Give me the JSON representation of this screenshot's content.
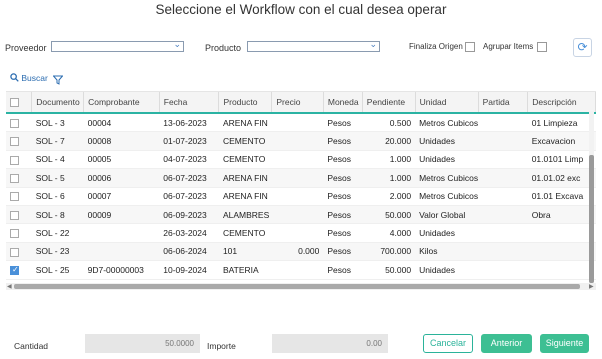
{
  "title": "Seleccione el Workflow con el cual desea operar",
  "filters": {
    "proveedor_label": "Proveedor",
    "producto_label": "Producto",
    "finaliza_label": "Finaliza Origen",
    "agrupar_label": "Agrupar Items"
  },
  "toolbar": {
    "search_label": "Buscar"
  },
  "table": {
    "columns": [
      "Documento",
      "Comprobante",
      "Fecha",
      "Producto",
      "Precio",
      "Moneda",
      "Pendiente",
      "Unidad",
      "Partida",
      "Descripción"
    ],
    "rows": [
      {
        "checked": false,
        "documento": "SOL - 3",
        "comprobante": "00004",
        "fecha": "13-06-2023",
        "producto": "ARENA FIN",
        "precio": "",
        "moneda": "Pesos",
        "pendiente": "0.500",
        "unidad": "Metros Cubicos",
        "partida": "",
        "descripcion": "01 Limpieza"
      },
      {
        "checked": false,
        "documento": "SOL - 7",
        "comprobante": "00008",
        "fecha": "01-07-2023",
        "producto": "CEMENTO",
        "precio": "",
        "moneda": "Pesos",
        "pendiente": "20.000",
        "unidad": "Unidades",
        "partida": "",
        "descripcion": "Excavacion"
      },
      {
        "checked": false,
        "documento": "SOL - 4",
        "comprobante": "00005",
        "fecha": "04-07-2023",
        "producto": "CEMENTO",
        "precio": "",
        "moneda": "Pesos",
        "pendiente": "1.000",
        "unidad": "Unidades",
        "partida": "",
        "descripcion": "01.0101 Limp"
      },
      {
        "checked": false,
        "documento": "SOL - 5",
        "comprobante": "00006",
        "fecha": "06-07-2023",
        "producto": "ARENA FIN",
        "precio": "",
        "moneda": "Pesos",
        "pendiente": "1.000",
        "unidad": "Metros Cubicos",
        "partida": "",
        "descripcion": "01.01.02 exc"
      },
      {
        "checked": false,
        "documento": "SOL - 6",
        "comprobante": "00007",
        "fecha": "06-07-2023",
        "producto": "ARENA FIN",
        "precio": "",
        "moneda": "Pesos",
        "pendiente": "2.000",
        "unidad": "Metros Cubicos",
        "partida": "",
        "descripcion": "01.01 Excava"
      },
      {
        "checked": false,
        "documento": "SOL - 8",
        "comprobante": "00009",
        "fecha": "06-09-2023",
        "producto": "ALAMBRES",
        "precio": "",
        "moneda": "Pesos",
        "pendiente": "50.000",
        "unidad": "Valor Global",
        "partida": "",
        "descripcion": "Obra"
      },
      {
        "checked": false,
        "documento": "SOL - 22",
        "comprobante": "",
        "fecha": "26-03-2024",
        "producto": "CEMENTO",
        "precio": "",
        "moneda": "Pesos",
        "pendiente": "4.000",
        "unidad": "Unidades",
        "partida": "",
        "descripcion": ""
      },
      {
        "checked": false,
        "documento": "SOL - 23",
        "comprobante": "",
        "fecha": "06-06-2024",
        "producto": "101",
        "precio": "0.000",
        "moneda": "Pesos",
        "pendiente": "700.000",
        "unidad": "Kilos",
        "partida": "",
        "descripcion": ""
      },
      {
        "checked": true,
        "documento": "SOL - 25",
        "comprobante": "9D7-00000003",
        "fecha": "10-09-2024",
        "producto": "BATERIA",
        "precio": "",
        "moneda": "Pesos",
        "pendiente": "50.000",
        "unidad": "Unidades",
        "partida": "",
        "descripcion": ""
      }
    ]
  },
  "footer": {
    "cantidad_label": "Cantidad",
    "cantidad_value": "50.0000",
    "importe_label": "Importe",
    "importe_value": "0.00",
    "cancel_label": "Cancelar",
    "prev_label": "Anterior",
    "next_label": "Siguiente"
  },
  "colors": {
    "accent": "#3dbf93",
    "header_border": "#2bb3a3",
    "link": "#2b6cb0"
  },
  "icons": {
    "search": "search-icon",
    "filter": "filter-icon",
    "refresh": "refresh-icon"
  }
}
